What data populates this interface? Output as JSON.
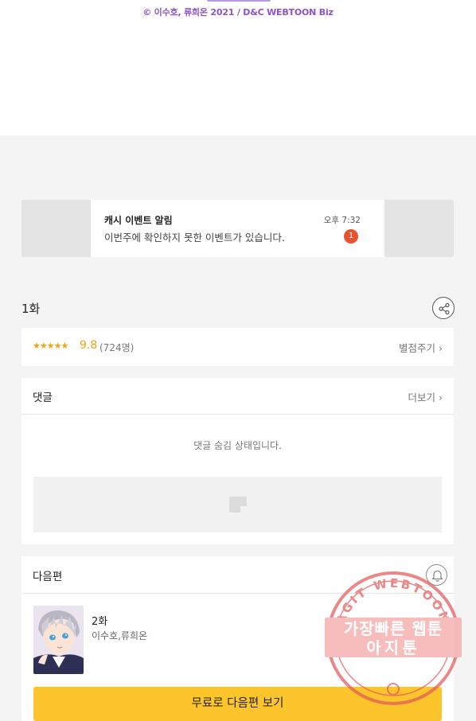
{
  "copyright": "© 이수호, 류희온 2021 / D&C WEBTOON Biz",
  "notification": {
    "title": "캐시 이벤트 알림",
    "message": "이번주에 확인하지 못한 이벤트가 있습니다.",
    "time": "오후 7:32",
    "badge": "1"
  },
  "episode": {
    "title": "1화",
    "share_icon": "share-icon"
  },
  "rating": {
    "stars": "★★★★★",
    "score": "9.8",
    "votes": "(724명)",
    "rate_link": "별점주기 ›"
  },
  "comments": {
    "title": "댓글",
    "more_link": "더보기 ›",
    "hidden_message": "댓글 숨김 상태입니다."
  },
  "next": {
    "title": "다음편",
    "bell_icon": "bell-icon",
    "episode": "2화",
    "authors": "이수호,류희온",
    "button": "무료로 다음편 보기"
  },
  "watermark": {
    "arc_text": "AGIT WEBTOON",
    "line1": "가장빠른 웹툰",
    "line2": "아지툰"
  },
  "colors": {
    "copyright": "#8e52c9",
    "rating": "#f2a415",
    "badge": "#e8532f",
    "cta": "#fcc52b",
    "watermark": "#e35a5a"
  }
}
